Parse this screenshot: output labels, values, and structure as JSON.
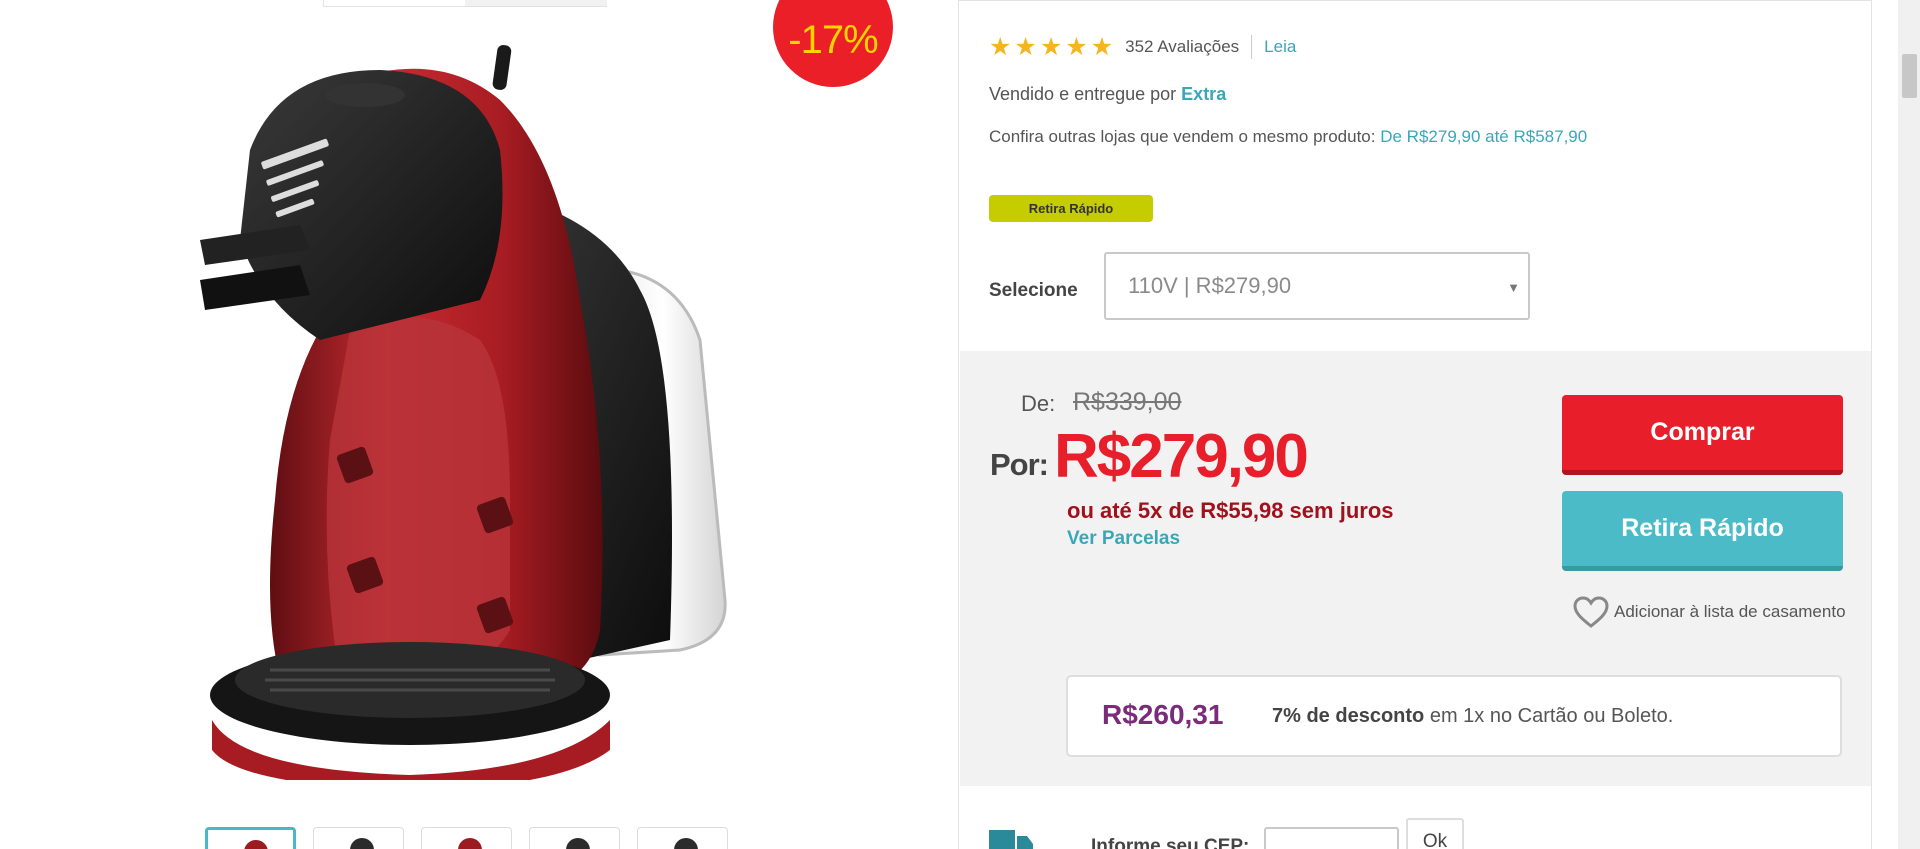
{
  "discount_badge": "-17%",
  "rating": {
    "stars": 5,
    "reviews_text": "352 Avaliações",
    "read_link": "Leia"
  },
  "seller": {
    "prefix": "Vendido e entregue por",
    "name": "Extra"
  },
  "compare": {
    "text": "Confira outras lojas que vendem o mesmo produto:",
    "range": "De R$279,90 até R$587,90"
  },
  "pickup_tag": "Retira Rápido",
  "variant": {
    "label": "Selecione",
    "selected": "110V | R$279,90"
  },
  "price": {
    "from_label": "De:",
    "old": "R$339,00",
    "por_label": "Por:",
    "current": "R$279,90",
    "installments": "ou até 5x de R$55,98 sem juros",
    "see_installments": "Ver Parcelas"
  },
  "buttons": {
    "buy": "Comprar",
    "pickup": "Retira Rápido"
  },
  "wishlist": "Adicionar à lista de casamento",
  "promo": {
    "price": "R$260,31",
    "discount_bold": "7% de desconto",
    "discount_rest": "em 1x no Cartão ou Boleto."
  },
  "shipping": {
    "cep_label": "Informe seu CEP:",
    "ok_button": "Ok"
  },
  "colors": {
    "accent_red": "#e81e2b",
    "accent_teal": "#4bbcc7",
    "link": "#3aa7b8",
    "promo_purple": "#7a2b7a",
    "tag_yellow": "#c5cd00"
  }
}
